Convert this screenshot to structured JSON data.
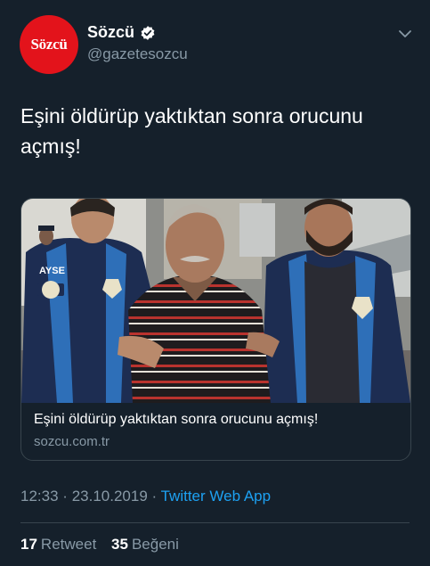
{
  "account": {
    "avatar_text": "Sözcü",
    "display_name": "Sözcü",
    "handle": "@gazetesozcu",
    "verified_icon": "verified-badge-icon"
  },
  "tweet": {
    "text": "Eşini öldürüp yaktıktan sonra orucunu açmış!"
  },
  "card": {
    "title": "Eşini öldürüp yaktıktan sonra orucunu açmış!",
    "domain": "sozcu.com.tr",
    "vest_text": "AYSE"
  },
  "meta": {
    "time": "12:33",
    "separator": "·",
    "date": "23.10.2019",
    "app": "Twitter Web App"
  },
  "stats": {
    "retweets": "17",
    "retweets_label": "Retweet",
    "likes": "35",
    "likes_label": "Beğeni"
  },
  "colors": {
    "background": "#15202b",
    "brand_red": "#e3131b",
    "link_blue": "#1da1f2",
    "secondary_text": "#8899a6"
  }
}
